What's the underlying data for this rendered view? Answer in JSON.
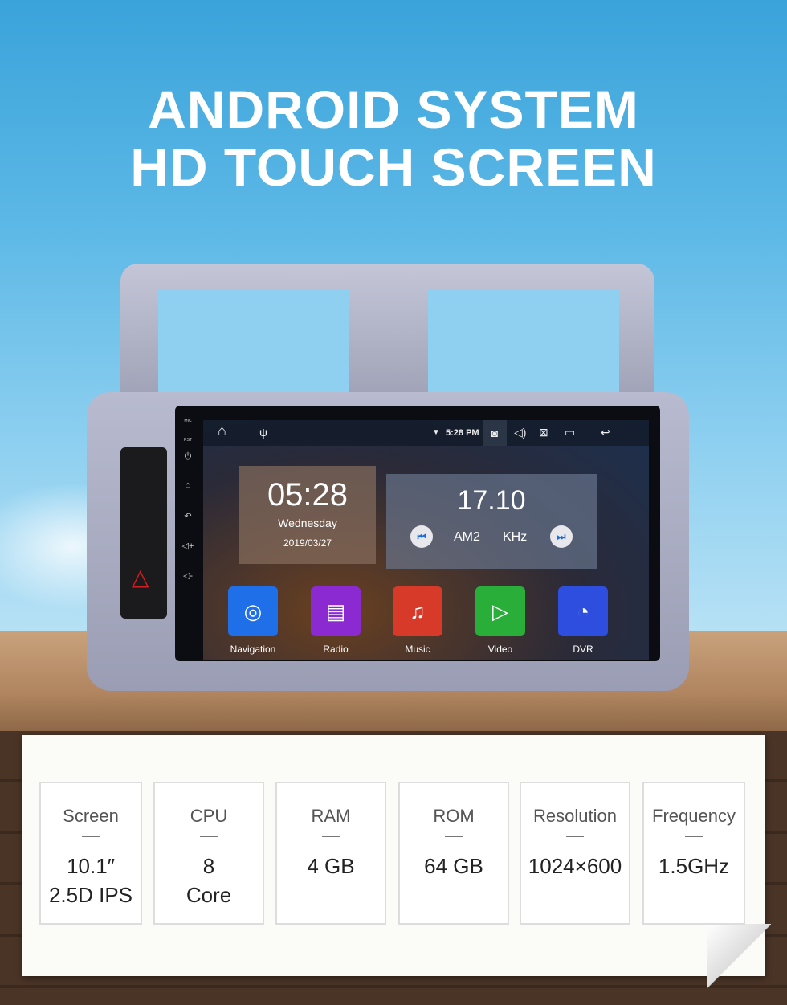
{
  "headline": {
    "line1": "ANDROID SYSTEM",
    "line2": "HD TOUCH SCREEN"
  },
  "device": {
    "side_labels": {
      "mic": "MIC",
      "rst": "RST"
    },
    "status": {
      "time": "5:28 PM"
    },
    "clock": {
      "time": "05:28",
      "day": "Wednesday",
      "date": "2019/03/27"
    },
    "radio": {
      "frequency": "17.10",
      "band": "AM2",
      "unit": "KHz"
    },
    "apps": [
      {
        "label": "Navigation",
        "icon": "navigation-icon",
        "color": "#1f6fe8"
      },
      {
        "label": "Radio",
        "icon": "radio-icon",
        "color": "#8a2ad0"
      },
      {
        "label": "Music",
        "icon": "music-icon",
        "color": "#d83a2a"
      },
      {
        "label": "Video",
        "icon": "video-icon",
        "color": "#2aae3a"
      },
      {
        "label": "DVR",
        "icon": "dvr-icon",
        "color": "#2e4ee0"
      }
    ]
  },
  "specs": [
    {
      "label": "Screen",
      "value1": "10.1″",
      "value2": "2.5D IPS"
    },
    {
      "label": "CPU",
      "value1": "8",
      "value2": "Core"
    },
    {
      "label": "RAM",
      "value1": "4 GB",
      "value2": ""
    },
    {
      "label": "ROM",
      "value1": "64 GB",
      "value2": ""
    },
    {
      "label": "Resolution",
      "value1": "1024×600",
      "value2": ""
    },
    {
      "label": "Frequency",
      "value1": "1.5GHz",
      "value2": ""
    }
  ]
}
